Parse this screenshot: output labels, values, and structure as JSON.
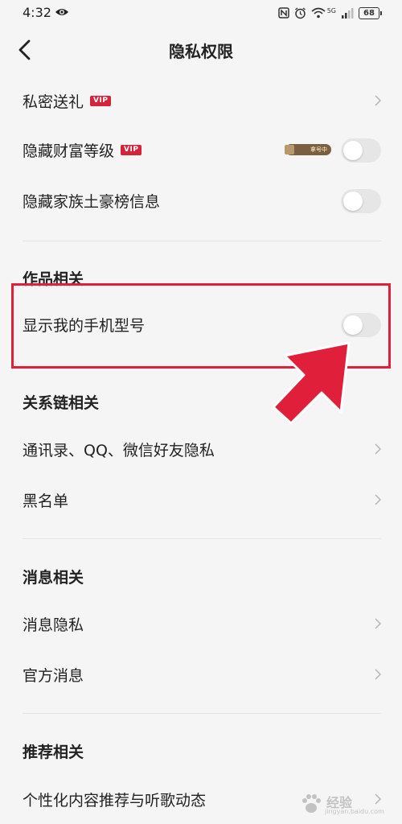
{
  "status_bar": {
    "time": "4:32",
    "network": "5G",
    "battery": "68"
  },
  "nav": {
    "title": "隐私权限"
  },
  "rows": {
    "private_gift": {
      "label": "私密送礼",
      "badge": "VIP"
    },
    "hide_wealth": {
      "label": "隐藏财富等级",
      "badge": "VIP",
      "trial": "拿号中",
      "toggle_on": false
    },
    "hide_family": {
      "label": "隐藏家族土豪榜信息",
      "toggle_on": false
    },
    "show_phone": {
      "label": "显示我的手机型号",
      "toggle_on": false
    },
    "contacts": {
      "label": "通讯录、QQ、微信好友隐私"
    },
    "blacklist": {
      "label": "黑名单"
    },
    "msg_privacy": {
      "label": "消息隐私"
    },
    "official_msg": {
      "label": "官方消息"
    },
    "personalized": {
      "label": "个性化内容推荐与听歌动态"
    }
  },
  "sections": {
    "works": "作品相关",
    "relations": "关系链相关",
    "messages": "消息相关",
    "recommend": "推荐相关"
  },
  "watermark": {
    "text": "经验",
    "url": "jingyan.baidu.com"
  },
  "colors": {
    "highlight": "#e0203a",
    "vip": "#d4233a",
    "toggle_off": "#e6e6e6"
  }
}
